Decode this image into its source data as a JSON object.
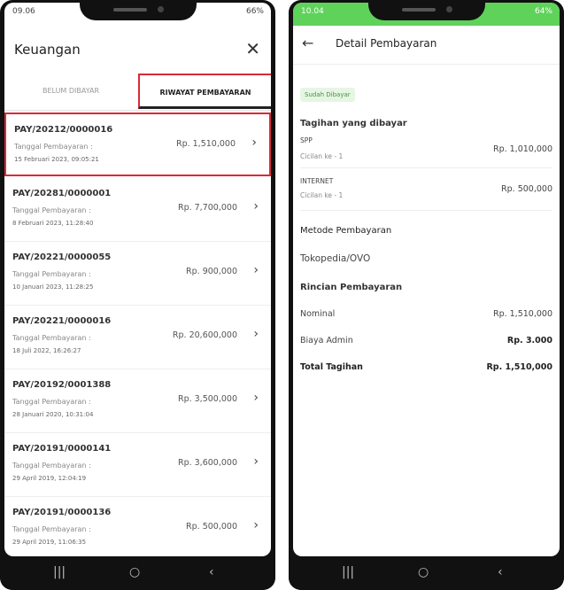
{
  "left": {
    "status": {
      "time": "09.06",
      "right": "66%"
    },
    "title": "Keuangan",
    "tabs": {
      "unpaid": "BELUM DIBAYAR",
      "history": "RIWAYAT PEMBAYARAN"
    },
    "date_label": "Tanggal Pembayaran :",
    "items": [
      {
        "code": "PAY/20212/0000016",
        "date": "15 Februari 2023, 09:05:21",
        "amount": "Rp. 1,510,000"
      },
      {
        "code": "PAY/20281/0000001",
        "date": "8 Februari 2023, 11:28:40",
        "amount": "Rp. 7,700,000"
      },
      {
        "code": "PAY/20221/0000055",
        "date": "10 Januari 2023, 11:28:25",
        "amount": "Rp. 900,000"
      },
      {
        "code": "PAY/20221/0000016",
        "date": "18 Juli 2022, 16:26:27",
        "amount": "Rp. 20,600,000"
      },
      {
        "code": "PAY/20192/0001388",
        "date": "28 Januari 2020, 10:31:04",
        "amount": "Rp. 3,500,000"
      },
      {
        "code": "PAY/20191/0000141",
        "date": "29 April 2019, 12:04:19",
        "amount": "Rp. 3,600,000"
      },
      {
        "code": "PAY/20191/0000136",
        "date": "29 April 2019, 11:06:35",
        "amount": "Rp. 500,000"
      }
    ]
  },
  "right": {
    "status": {
      "time": "10.04",
      "right": "64%"
    },
    "title": "Detail Pembayaran",
    "badge": "Sudah Dibayar",
    "bills_title": "Tagihan yang dibayar",
    "bills": [
      {
        "name": "SPP",
        "sub": "Cicilan ke - 1",
        "amount": "Rp. 1,010,000"
      },
      {
        "name": "INTERNET",
        "sub": "Cicilan ke - 1",
        "amount": "Rp. 500,000"
      }
    ],
    "method_title": "Metode Pembayaran",
    "method": "Tokopedia/OVO",
    "detail_title": "Rincian Pembayaran",
    "nominal_label": "Nominal",
    "nominal": "Rp. 1,510,000",
    "admin_label": "Biaya Admin",
    "admin": "Rp. 3.000",
    "total_label": "Total Tagihan",
    "total": "Rp. 1,510,000"
  },
  "nav": {
    "recent": "|||",
    "home": "○",
    "back": "‹"
  }
}
